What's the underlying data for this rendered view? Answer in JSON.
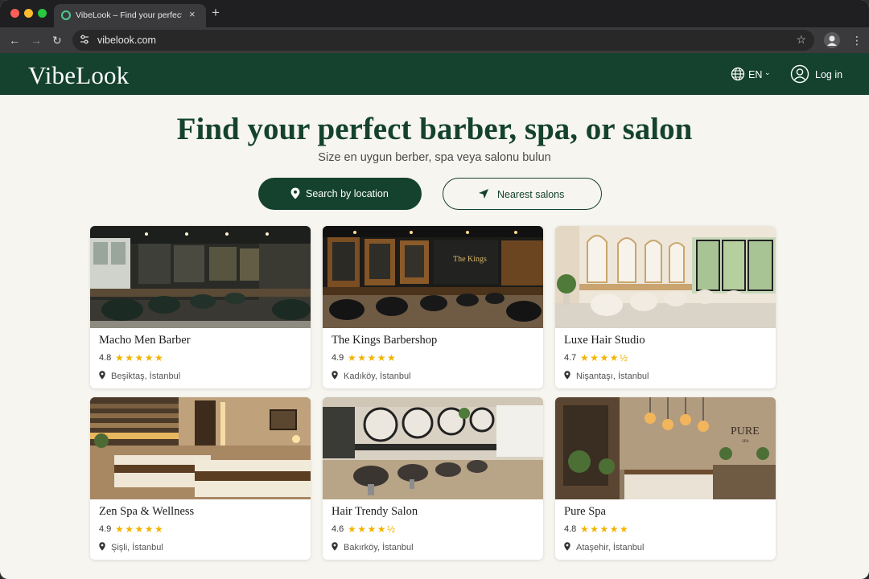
{
  "browser": {
    "tab_title": "VibeLook – Find your perfect barber",
    "tab_close": "×",
    "new_tab": "+",
    "url": "vibelook.com",
    "back": "←",
    "forward": "→",
    "reload": "↻",
    "bookmark": "☆",
    "menu": "⋮"
  },
  "header": {
    "logo": "VibeLook",
    "language": "EN",
    "language_chevron": "⌄",
    "login": "Log in",
    "brand_color": "#14422f"
  },
  "hero": {
    "title": "Find your perfect barber, spa, or salon",
    "subtitle": "Size en uygun berber, spa veya salonu bulun",
    "search_button": "Search by location",
    "nearest_button": "Nearest salons"
  },
  "salons": [
    {
      "name": "Macho Men Barber",
      "rating": "4.8",
      "stars": "★★★★★",
      "location": "Beşiktaş, İstanbul",
      "image_theme": "dark-barbershop"
    },
    {
      "name": "The Kings Barbershop",
      "rating": "4.9",
      "stars": "★★★★★",
      "location": "Kadıköy, İstanbul",
      "image_theme": "wood-barbershop",
      "sign_text": "The Kings"
    },
    {
      "name": "Luxe Hair Studio",
      "rating": "4.7",
      "stars": "★★★★½",
      "location": "Nişantaşı, İstanbul",
      "image_theme": "bright-salon"
    },
    {
      "name": "Zen Spa & Wellness",
      "rating": "4.9",
      "stars": "★★★★★",
      "location": "Şişli, İstanbul",
      "image_theme": "spa-room"
    },
    {
      "name": "Hair Trendy Salon",
      "rating": "4.6",
      "stars": "★★★★½",
      "location": "Bakırköy, İstanbul",
      "image_theme": "mirror-salon"
    },
    {
      "name": "Pure Spa",
      "rating": "4.8",
      "stars": "★★★★★",
      "location": "Ataşehir, İstanbul",
      "image_theme": "spa-reception",
      "sign_text": "PURE",
      "sign_subtext": "SPA"
    }
  ],
  "colors": {
    "star": "#f2b300",
    "page_bg": "#f7f5ef"
  }
}
